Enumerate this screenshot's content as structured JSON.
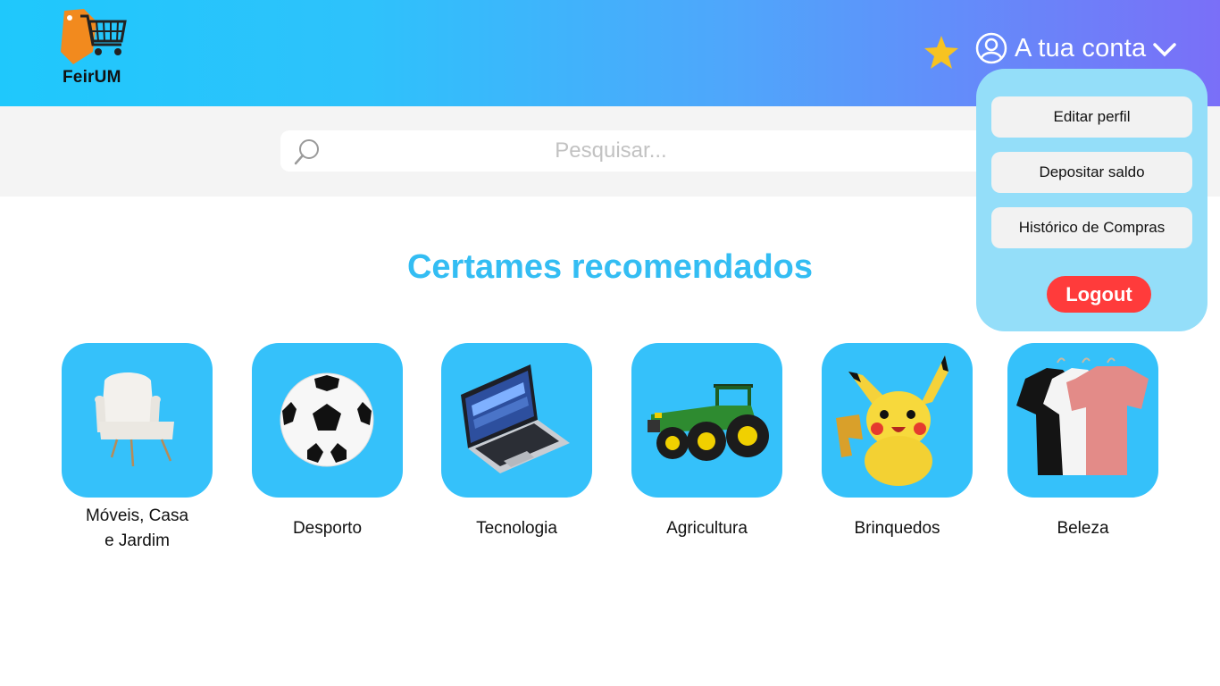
{
  "header": {
    "logo_text": "FeirUM",
    "account_label": "A tua conta"
  },
  "search": {
    "placeholder": "Pesquisar..."
  },
  "account_menu": {
    "items": [
      "Editar perfil",
      "Depositar saldo",
      "Histórico de Compras"
    ],
    "logout_label": "Logout"
  },
  "main": {
    "section_title": "Certames recomendados",
    "categories": [
      {
        "label_line1": "Móveis, Casa",
        "label_line2": "e Jardim",
        "icon": "armchair-icon"
      },
      {
        "label": "Desporto",
        "icon": "soccer-ball-icon"
      },
      {
        "label": "Tecnologia",
        "icon": "laptop-icon"
      },
      {
        "label": "Agricultura",
        "icon": "tractor-icon"
      },
      {
        "label": "Brinquedos",
        "icon": "plush-toy-icon"
      },
      {
        "label": "Beleza",
        "icon": "tshirts-icon"
      }
    ]
  },
  "colors": {
    "header_gradient_start": "#1fc8fc",
    "header_gradient_end": "#7a6ff8",
    "accent": "#33bdf3",
    "tile": "#35c1fa",
    "dropdown_bg": "#94def9",
    "logout": "#ff3b3b",
    "favorite_star": "#f7c321"
  }
}
